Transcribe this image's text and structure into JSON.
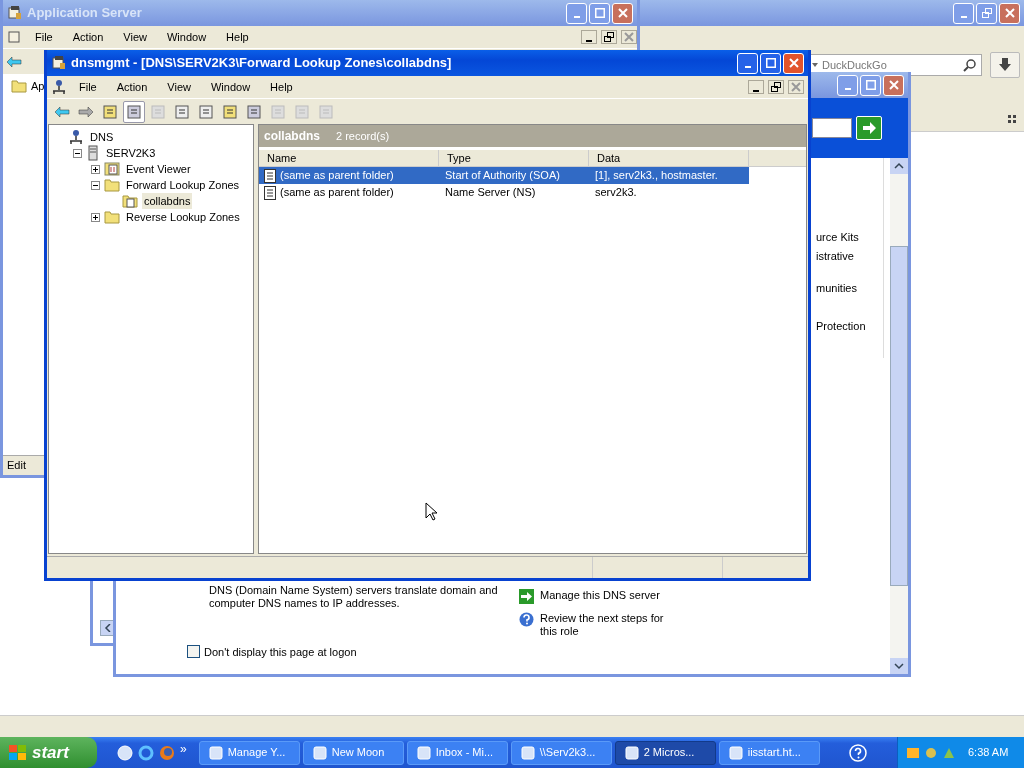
{
  "browser_window": {
    "search": {
      "placeholder": "DuckDuckGo"
    }
  },
  "app_server_window": {
    "title": "Application Server",
    "menu": [
      "File",
      "Action",
      "View",
      "Window",
      "Help"
    ],
    "tree_item": "Ap",
    "status": "Edit"
  },
  "manage_server_window": {
    "side_links": [
      "urce Kits",
      "istrative",
      "munities",
      "Protection"
    ],
    "description": "DNS (Domain Name System) servers translate domain and computer DNS names to IP addresses.",
    "actions": [
      {
        "kind": "go",
        "label": "Manage this DNS server"
      },
      {
        "kind": "help",
        "label": "Review the next steps for this role"
      }
    ],
    "dont_display": {
      "label": "Don't display this page at logon",
      "checked": false
    }
  },
  "dns_window": {
    "title": "dnsmgmt - [DNS\\SERV2K3\\Forward Lookup Zones\\collabdns]",
    "menu": [
      "File",
      "Action",
      "View",
      "Window",
      "Help"
    ],
    "tree": [
      {
        "label": "DNS",
        "kind": "dns",
        "selected": false,
        "children": [
          {
            "label": "SERV2K3",
            "kind": "server",
            "expanded": true,
            "selected": false,
            "children": [
              {
                "label": "Event Viewer",
                "kind": "event-log",
                "expanded": false,
                "selected": false
              },
              {
                "label": "Forward Lookup Zones",
                "kind": "folder",
                "expanded": true,
                "selected": false,
                "children": [
                  {
                    "label": "collabdns",
                    "kind": "zone",
                    "selected": true
                  }
                ]
              },
              {
                "label": "Reverse Lookup Zones",
                "kind": "folder",
                "expanded": false,
                "selected": false
              }
            ]
          }
        ]
      }
    ],
    "result_title": "collabdns",
    "record_count": "2 record(s)",
    "columns": [
      "Name",
      "Type",
      "Data"
    ],
    "rows": [
      {
        "name": "(same as parent folder)",
        "type": "Start of Authority (SOA)",
        "data": "[1], serv2k3., hostmaster.",
        "selected": true
      },
      {
        "name": "(same as parent folder)",
        "type": "Name Server (NS)",
        "data": "serv2k3.",
        "selected": false
      }
    ]
  },
  "taskbar": {
    "start": "start",
    "chevron": "»",
    "tasks": [
      {
        "label": "Manage Y...",
        "selected": false
      },
      {
        "label": "New Moon",
        "selected": false
      },
      {
        "label": "Inbox - Mi...",
        "selected": false
      },
      {
        "label": "\\\\Serv2k3...",
        "selected": false
      },
      {
        "label": "2 Micros...",
        "selected": true
      },
      {
        "label": "iisstart.ht...",
        "selected": false
      }
    ],
    "clock": "6:38 AM"
  }
}
